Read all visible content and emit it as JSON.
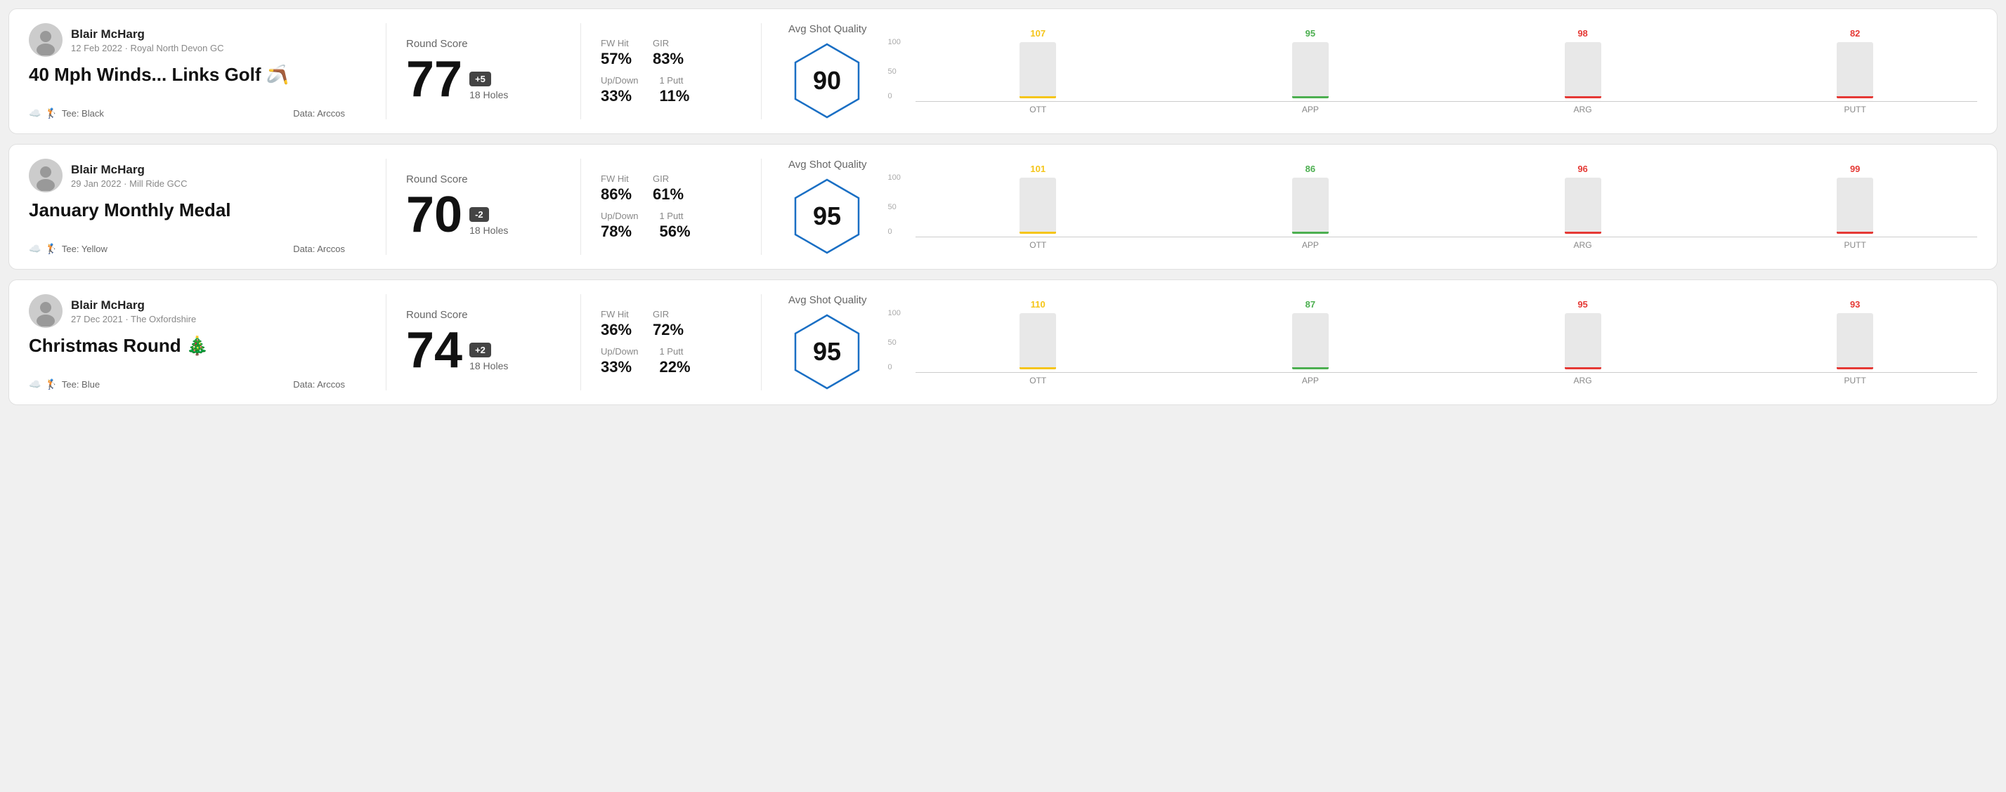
{
  "rounds": [
    {
      "id": "round1",
      "user_name": "Blair McHarg",
      "date": "12 Feb 2022 · Royal North Devon GC",
      "title": "40 Mph Winds... Links Golf 🪃",
      "tee": "Black",
      "data_source": "Data: Arccos",
      "score": "77",
      "score_diff": "+5",
      "holes": "18 Holes",
      "fw_hit": "57%",
      "gir": "83%",
      "up_down": "33%",
      "one_putt": "11%",
      "avg_quality": "90",
      "chart": {
        "ott": {
          "value": 107,
          "color": "#f5c518"
        },
        "app": {
          "value": 95,
          "color": "#4caf50"
        },
        "arg": {
          "value": 98,
          "color": "#e53935"
        },
        "putt": {
          "value": 82,
          "color": "#e53935"
        }
      }
    },
    {
      "id": "round2",
      "user_name": "Blair McHarg",
      "date": "29 Jan 2022 · Mill Ride GCC",
      "title": "January Monthly Medal",
      "tee": "Yellow",
      "data_source": "Data: Arccos",
      "score": "70",
      "score_diff": "-2",
      "holes": "18 Holes",
      "fw_hit": "86%",
      "gir": "61%",
      "up_down": "78%",
      "one_putt": "56%",
      "avg_quality": "95",
      "chart": {
        "ott": {
          "value": 101,
          "color": "#f5c518"
        },
        "app": {
          "value": 86,
          "color": "#4caf50"
        },
        "arg": {
          "value": 96,
          "color": "#e53935"
        },
        "putt": {
          "value": 99,
          "color": "#e53935"
        }
      }
    },
    {
      "id": "round3",
      "user_name": "Blair McHarg",
      "date": "27 Dec 2021 · The Oxfordshire",
      "title": "Christmas Round 🎄",
      "tee": "Blue",
      "data_source": "Data: Arccos",
      "score": "74",
      "score_diff": "+2",
      "holes": "18 Holes",
      "fw_hit": "36%",
      "gir": "72%",
      "up_down": "33%",
      "one_putt": "22%",
      "avg_quality": "95",
      "chart": {
        "ott": {
          "value": 110,
          "color": "#f5c518"
        },
        "app": {
          "value": 87,
          "color": "#4caf50"
        },
        "arg": {
          "value": 95,
          "color": "#e53935"
        },
        "putt": {
          "value": 93,
          "color": "#e53935"
        }
      }
    }
  ],
  "labels": {
    "round_score": "Round Score",
    "fw_hit": "FW Hit",
    "gir": "GIR",
    "up_down": "Up/Down",
    "one_putt": "1 Putt",
    "avg_quality": "Avg Shot Quality",
    "ott": "OTT",
    "app": "APP",
    "arg": "ARG",
    "putt": "PUTT"
  }
}
